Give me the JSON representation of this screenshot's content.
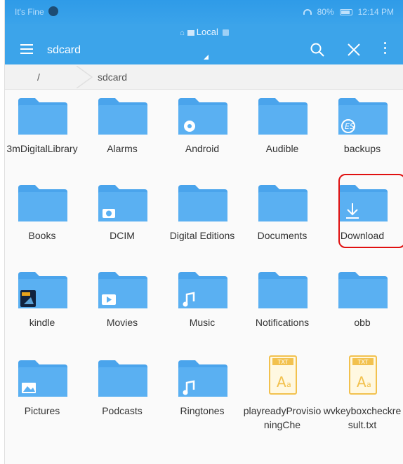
{
  "status_bar": {
    "carrier": "It's Fine",
    "battery": "80%",
    "time": "12:14 PM"
  },
  "app_bar": {
    "location": "Local",
    "title": "sdcard",
    "icons": [
      "menu-icon",
      "search-icon",
      "close-icon",
      "more-vert-icon"
    ]
  },
  "breadcrumb": {
    "items": [
      "/",
      "sdcard"
    ]
  },
  "files": [
    {
      "name": "3mDigitalLibrary",
      "type": "folder",
      "icon": "folder-icon"
    },
    {
      "name": "Alarms",
      "type": "folder",
      "icon": "folder-icon"
    },
    {
      "name": "Android",
      "type": "folder",
      "icon": "folder-settings-icon"
    },
    {
      "name": "Audible",
      "type": "folder",
      "icon": "folder-icon"
    },
    {
      "name": "backups",
      "type": "folder",
      "icon": "folder-es-icon"
    },
    {
      "name": "Books",
      "type": "folder",
      "icon": "folder-icon"
    },
    {
      "name": "DCIM",
      "type": "folder",
      "icon": "folder-camera-icon"
    },
    {
      "name": "Digital Editions",
      "type": "folder",
      "icon": "folder-icon"
    },
    {
      "name": "Documents",
      "type": "folder",
      "icon": "folder-icon"
    },
    {
      "name": "Download",
      "type": "folder",
      "icon": "folder-download-icon",
      "highlighted": true
    },
    {
      "name": "kindle",
      "type": "folder",
      "icon": "folder-kindle-icon"
    },
    {
      "name": "Movies",
      "type": "folder",
      "icon": "folder-video-icon"
    },
    {
      "name": "Music",
      "type": "folder",
      "icon": "folder-music-icon"
    },
    {
      "name": "Notifications",
      "type": "folder",
      "icon": "folder-icon"
    },
    {
      "name": "obb",
      "type": "folder",
      "icon": "folder-icon"
    },
    {
      "name": "Pictures",
      "type": "folder",
      "icon": "folder-picture-icon"
    },
    {
      "name": "Podcasts",
      "type": "folder",
      "icon": "folder-icon"
    },
    {
      "name": "Ringtones",
      "type": "folder",
      "icon": "folder-music-icon"
    },
    {
      "name": "playreadyProvisioningChe",
      "type": "txt",
      "icon": "txt-file-icon",
      "badge": "TXT"
    },
    {
      "name": "wvkeyboxcheckresult.txt",
      "type": "txt",
      "icon": "txt-file-icon",
      "badge": "TXT"
    }
  ],
  "colors": {
    "app_bar": "#3ca4ea",
    "folder": "#5ab0f2",
    "folder_tab": "#4aa4ec",
    "txt_icon": "#f2c14e",
    "highlight": "#e01010"
  }
}
